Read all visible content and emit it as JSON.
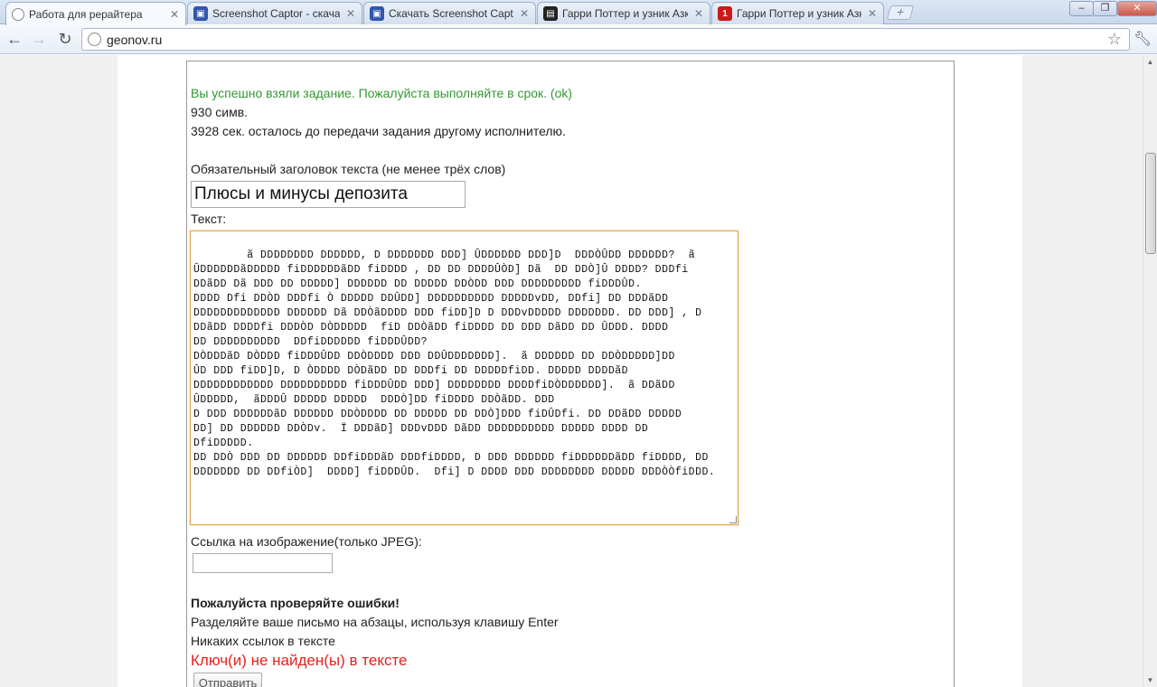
{
  "browser": {
    "tabs": [
      {
        "title": "Работа для рерайтера",
        "favicon": "globe-icon",
        "color": "#888888"
      },
      {
        "title": "Screenshot Captor - скачат",
        "favicon": "captor-icon",
        "color": "#3355aa"
      },
      {
        "title": "Скачать Screenshot Captor",
        "favicon": "captor-icon",
        "color": "#3355aa"
      },
      {
        "title": "Гарри Поттер и узник Азка",
        "favicon": "clapper-icon",
        "color": "#222222"
      },
      {
        "title": "Гарри Поттер и узник Азка",
        "favicon": "channel-one-icon",
        "color": "#cc1a1a"
      }
    ],
    "url": "geonov.ru"
  },
  "page": {
    "success_message": "Вы успешно взяли задание. Пожалуйста выполняйте в срок. (ok)",
    "char_count": "930 симв.",
    "time_left": "3928 сек. осталось до передачи задания другому исполнителю.",
    "title_label": "Обязательный заголовок текста (не менее трёх слов)",
    "title_value": "Плюсы и минусы депозита",
    "text_label": "Текст:",
    "text_body": "ã DDDDDDDD DDDDDD, D DDDDDDD DDD] ÛDDDDDD DDD]D  DDDÒÛDD DDDDDD?  ã\nÛDDDDDDãDDDDD fiDDDDDDãDD fiDDDD , DD DD DDDDÛÒD] Dã  DD DDÒ]Û DDDD? DDDfi\nDDãDD Dã DDD DD DDDDD] DDDDDD DD DDDDD DDÒDD DDD DDDDDDDDD fiDDDÛD.\nDDDD Dfi DDÒD DDDfi Ò DDDDD DDÛDD] DDDDDDDDDD DDDDDvDD, DDfi] DD DDDãDD\nDDDDDDDDDDDDD DDDDDD Dã DDÒãDDDD DDD fiDD]D D DDDvDDDDD DDDDDDD. DD DDD] , D\nDDãDD DDDDfi DDDÒD DÒDDDDD  fiD DDÒãDD fiDDDD DD DDD DãDD DD ÛDDD. DDDD\nDD DDDDDDDDDD  DDfiDDDDDD fiDDDÛDD?\nDÒDDDãD DÒDDD fiDDDÛDD DDÒDDDD DDD DDÛDDDDDDD].  ã DDDDDD DD DDÒDDDDD]DD\nÛD DDD fiDD]D, D ÒDDDD DÒDãDD DD DDDfi DD DDDDDfiDD. DDDDD DDDDãD\nDDDDDDDDDDDD DDDDDDDDDD fiDDDÛDD DDD] DDDDDDDD DDDDfiDÒDDDDDD].  ã DDãDD\nÛDDDDD,  ãDDDÛ DDDDD DDDDD  DDDÒ]DD fiDDDD DDÒãDD. DDD\nD DDD DDDDDDãD DDDDDD DDÒDDDD DD DDDDD DD DDÒ]DDD fiDÛDfi. DD DDãDD DDDDD\nDD] DD DDDDDD DDÒDv.  Ï DDDãD] DDDvDDD DãDD DDDDDDDDDD DDDDD DDDD DD\nDfiDDDDD.\nDD DDÒ DDD DD DDDDDD DDfiDDDãD DDDfiDDDD, D DDD DDDDDD fiDDDDDDãDD fiDDDD, DD\nDDDDDDD DD DDfiÒD]  DDDD] fiDDDÛD.  Dfi] D DDDD DDD DDDDDDDD DDDDD DDDÒÒfiDDD.",
    "image_link_label": "Ссылка на изображение(только JPEG):",
    "image_link_value": "",
    "check_heading": "Пожалуйста проверяйте ошибки!",
    "paragraph_hint": "Разделяйте ваше письмо на абзацы, используя клавишу Enter",
    "no_links_hint": "Никаких ссылок в тексте",
    "keys_error": "Ключ(и) не найден(ы) в тексте",
    "submit_label": "Отправить"
  },
  "colors": {
    "success": "#339933",
    "error": "#e62020",
    "textarea_focus_border": "#e1a84a"
  }
}
